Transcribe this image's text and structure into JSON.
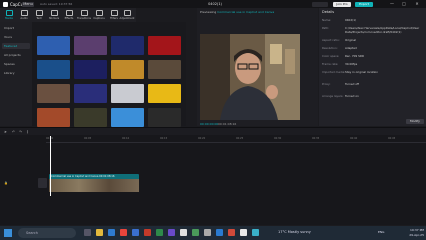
{
  "titlebar": {
    "app_name": "CapCut",
    "menu_label": "Menu",
    "autosave": "Auto saved: 19:37:56",
    "project_title": "0402(1)",
    "join_pro": "Join Pro",
    "export": "Export",
    "min": "—",
    "max": "□",
    "close": "✕"
  },
  "tools": [
    {
      "label": "Media",
      "active": true
    },
    {
      "label": "Audio"
    },
    {
      "label": "Text"
    },
    {
      "label": "Stickers"
    },
    {
      "label": "Effects"
    },
    {
      "label": "Transitions"
    },
    {
      "label": "Captions"
    },
    {
      "label": "Filters"
    },
    {
      "label": "Adjustment"
    }
  ],
  "sidebar": {
    "items": [
      {
        "label": "Import"
      },
      {
        "label": "Yours"
      },
      {
        "label": "Featured",
        "active": true
      },
      {
        "label": "All projects"
      },
      {
        "label": "Spaces"
      },
      {
        "label": "Library"
      }
    ]
  },
  "media": {
    "thumb_colors": [
      "#2e5fb0",
      "#5b3e6e",
      "#1f2a6b",
      "#a3151a",
      "#1a4f8a",
      "#1c1f5f",
      "#c08a2a",
      "#5a4a3a",
      "#6a5040",
      "#2a2e7a",
      "#c9cbd1",
      "#e8b916",
      "#a34a2a",
      "#3a3a2a",
      "#3b8fd9",
      "#2a2a2a"
    ]
  },
  "player": {
    "header_prefix": "Previewing",
    "header_title": "Commercial use in CapCut and Canva",
    "time_current": "00:00:00:00",
    "time_total": "00:01:08:16"
  },
  "details": {
    "title": "Details",
    "rows": [
      {
        "k": "Name:",
        "v": "0402(1)"
      },
      {
        "k": "Path:",
        "v": "C:/Users/Alex Hervaniels/AppData/Local/CapCut/User Data/Projects/com.lveditor.draft/0402(1)"
      },
      {
        "k": "Aspect ratio:",
        "v": "Original"
      },
      {
        "k": "Resolution:",
        "v": "Adapted"
      },
      {
        "k": "Color space:",
        "v": "Rec. 709 SDR"
      },
      {
        "k": "Frame rate:",
        "v": "30.00fps"
      },
      {
        "k": "Imported media:",
        "v": "Stay in original location"
      },
      {
        "k": "Proxy:",
        "v": "Turned off"
      },
      {
        "k": "Arrange layers:",
        "v": "Turned on"
      }
    ],
    "modify": "Modify"
  },
  "timeline": {
    "ticks": [
      "00:00",
      "00:05",
      "00:10",
      "00:15",
      "00:20",
      "00:25",
      "00:30",
      "00:35",
      "00:40",
      "00:45"
    ],
    "clip_label": "Commercial use in CapCut and Canva  00:01:08:16"
  },
  "taskbar": {
    "search": "Search",
    "weather": "17°C  Mostly sunny",
    "lang": "ENG",
    "time": "19:37 PM",
    "date": "29-Apr-25"
  }
}
